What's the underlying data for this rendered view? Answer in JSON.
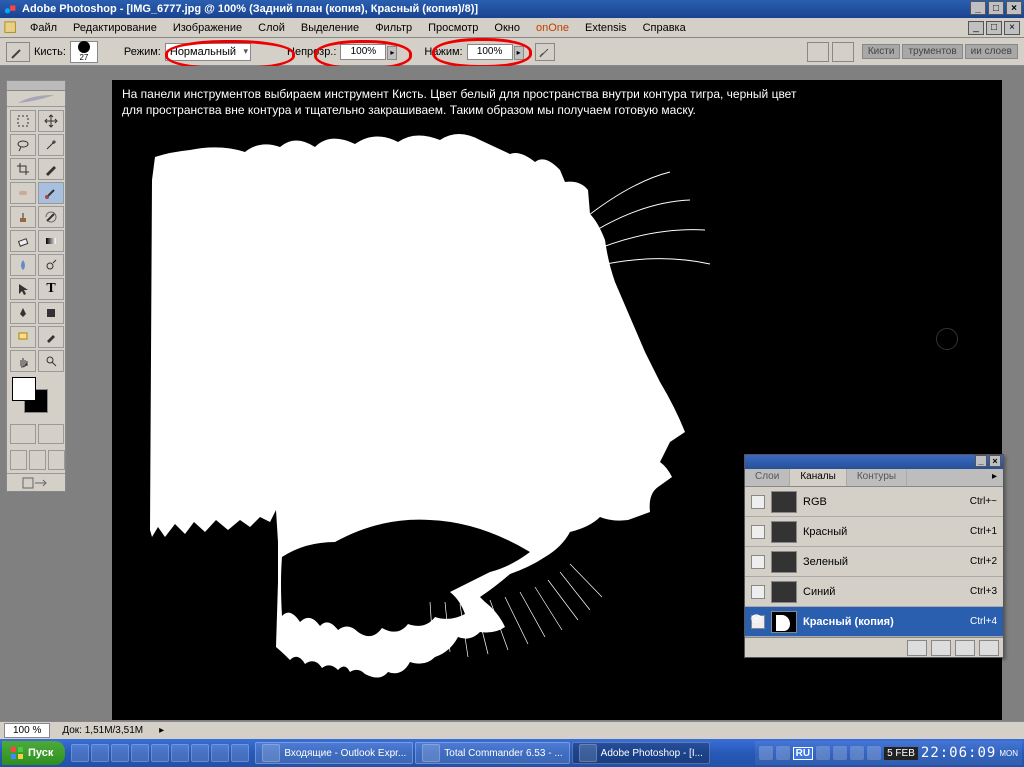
{
  "app": {
    "name": "Adobe Photoshop",
    "document": "[IMG_6777.jpg @ 100% (Задний план (копия), Красный (копия)/8)]"
  },
  "menu": {
    "items": [
      "Файл",
      "Редактирование",
      "Изображение",
      "Слой",
      "Выделение",
      "Фильтр",
      "Просмотр",
      "Окно",
      "onOne",
      "Extensis",
      "Справка"
    ]
  },
  "options": {
    "brush_label": "Кисть:",
    "brush_size": "27",
    "mode_label": "Режим:",
    "mode_value": "Нормальный",
    "opacity_label": "Непрозр.:",
    "opacity_value": "100%",
    "flow_label": "Нажим:",
    "flow_value": "100%",
    "well_tabs": [
      "Кисти",
      "трументов",
      "ии слоев"
    ]
  },
  "canvas_text": {
    "line1": "На панели инструментов выбираем инструмент Кисть. Цвет белый для пространства внутри контура тигра, черный цвет",
    "line2": "для пространства вне контура и тщательно закрашиваем. Таким образом мы получаем готовую маску."
  },
  "channels": {
    "tabs": [
      "Слои",
      "Каналы",
      "Контуры"
    ],
    "rows": [
      {
        "name": "RGB",
        "shortcut": "Ctrl+~",
        "eye": false
      },
      {
        "name": "Красный",
        "shortcut": "Ctrl+1",
        "eye": false
      },
      {
        "name": "Зеленый",
        "shortcut": "Ctrl+2",
        "eye": false
      },
      {
        "name": "Синий",
        "shortcut": "Ctrl+3",
        "eye": false
      },
      {
        "name": "Красный (копия)",
        "shortcut": "Ctrl+4",
        "eye": true,
        "selected": true
      }
    ]
  },
  "status": {
    "zoom": "100 %",
    "doc": "Док: 1,51M/3,51M"
  },
  "taskbar": {
    "start": "Пуск",
    "tasks": [
      {
        "label": "Входящие - Outlook Expr..."
      },
      {
        "label": "Total Commander 6.53 - ..."
      },
      {
        "label": "Adobe Photoshop - [I...",
        "active": true
      }
    ],
    "lang": "RU",
    "date": "5 FEB",
    "time": "22:06:09",
    "day": "MON"
  },
  "tools": {
    "names": [
      "move",
      "marquee",
      "lasso",
      "magic-wand",
      "crop",
      "slice",
      "healing",
      "brush",
      "clone",
      "history-brush",
      "eraser",
      "gradient",
      "blur",
      "dodge",
      "path-select",
      "type",
      "pen",
      "shape",
      "notes",
      "eyedropper",
      "hand",
      "zoom"
    ]
  }
}
